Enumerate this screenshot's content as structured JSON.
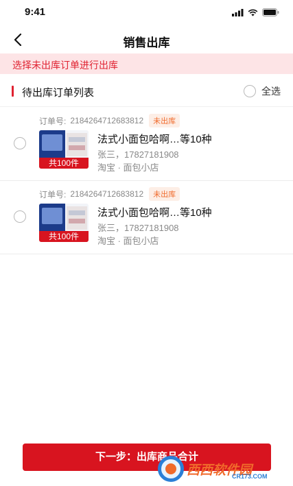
{
  "status_bar": {
    "time": "9:41"
  },
  "nav": {
    "title": "销售出库"
  },
  "hint": {
    "text": "选择未出库订单进行出库"
  },
  "section": {
    "title": "待出库订单列表",
    "select_all_label": "全选"
  },
  "orders": [
    {
      "order_no_label": "订单号:",
      "order_no": "2184264712683812",
      "status": "未出库",
      "product": "法式小面包哈啊…等10种",
      "customer": "张三，17827181908",
      "shop": "淘宝 · 面包小店",
      "count": "共100件"
    },
    {
      "order_no_label": "订单号:",
      "order_no": "2184264712683812",
      "status": "未出库",
      "product": "法式小面包哈啊…等10种",
      "customer": "张三，17827181908",
      "shop": "淘宝 · 面包小店",
      "count": "共100件"
    }
  ],
  "footer": {
    "next_button": "下一步：出库商品合计"
  },
  "watermark": {
    "text": "西西软件园",
    "url": "CR173.COM"
  },
  "colors": {
    "accent": "#d8141f",
    "hint_bg": "#fde4e6",
    "badge": "#f06a2b"
  }
}
